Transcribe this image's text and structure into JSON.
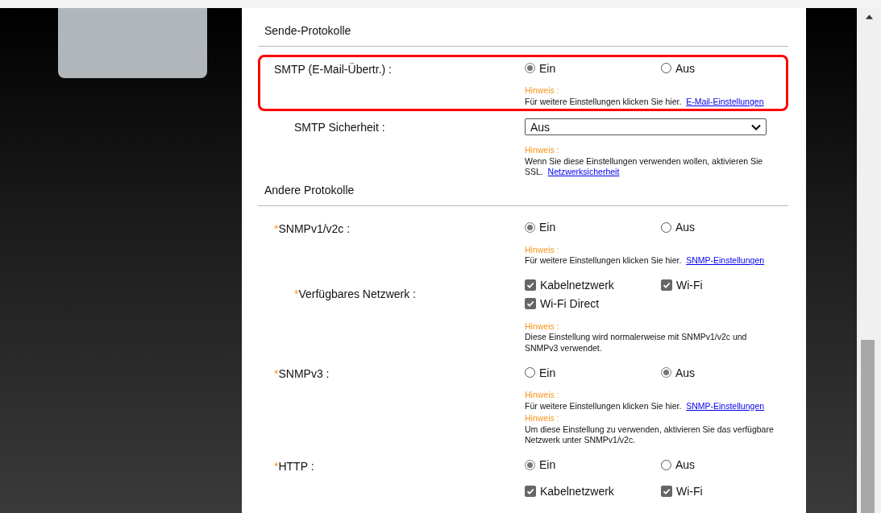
{
  "sections": [
    {
      "title": "Sende-Protokolle",
      "rows": [
        {
          "label": "SMTP (E-Mail-Übertr.) :",
          "sub": false,
          "highlighted": true,
          "kind": "radio",
          "options": [
            {
              "label": "Ein",
              "selected": true
            },
            {
              "label": "Aus",
              "selected": false
            }
          ],
          "notes": [
            {
              "label": "Hinweis :",
              "text": "Für weitere Einstellungen klicken Sie hier.",
              "link": "E-Mail-Einstellungen"
            }
          ]
        },
        {
          "label": "SMTP Sicherheit :",
          "sub": true,
          "highlighted": false,
          "kind": "select",
          "value": "Aus",
          "notes": [
            {
              "label": "Hinweis :",
              "text": "Wenn Sie diese Einstellungen verwenden wollen, aktivieren Sie SSL.",
              "link": "Netzwerksicherheit"
            }
          ]
        }
      ]
    },
    {
      "title": "Andere Protokolle",
      "rows": [
        {
          "marker": "*",
          "label": "SNMPv1/v2c :",
          "sub": false,
          "highlighted": false,
          "kind": "radio",
          "options": [
            {
              "label": "Ein",
              "selected": true
            },
            {
              "label": "Aus",
              "selected": false
            }
          ],
          "notes": [
            {
              "label": "Hinweis :",
              "text": "Für weitere Einstellungen klicken Sie hier.",
              "link": "SNMP-Einstellungen"
            }
          ]
        },
        {
          "marker": "*",
          "label": "Verfügbares Netzwerk :",
          "sub": true,
          "highlighted": false,
          "kind": "checkboxes",
          "options": [
            {
              "label": "Kabelnetzwerk",
              "checked": true
            },
            {
              "label": "Wi-Fi",
              "checked": true
            },
            {
              "label": "Wi-Fi Direct",
              "checked": true
            }
          ],
          "notes": [
            {
              "label": "Hinweis :",
              "text": "Diese Einstellung wird normalerweise mit SNMPv1/v2c und SNMPv3 verwendet."
            }
          ]
        },
        {
          "marker": "*",
          "label": "SNMPv3 :",
          "sub": false,
          "highlighted": false,
          "kind": "radio",
          "options": [
            {
              "label": "Ein",
              "selected": false
            },
            {
              "label": "Aus",
              "selected": true
            }
          ],
          "notes": [
            {
              "label": "Hinweis :",
              "text": "Für weitere Einstellungen klicken Sie hier.",
              "link": "SNMP-Einstellungen"
            },
            {
              "label": "Hinweis :",
              "text": "Um diese Einstellung zu verwenden, aktivieren Sie das verfügbare Netzwerk unter SNMPv1/v2c."
            }
          ]
        },
        {
          "marker": "*",
          "label": "HTTP :",
          "sub": false,
          "highlighted": false,
          "kind": "radio",
          "options": [
            {
              "label": "Ein",
              "selected": true
            },
            {
              "label": "Aus",
              "selected": false
            }
          ],
          "notes": []
        },
        {
          "sub": true,
          "highlighted": false,
          "kind": "checkboxes",
          "options": [
            {
              "label": "Kabelnetzwerk",
              "checked": true
            },
            {
              "label": "Wi-Fi",
              "checked": true
            }
          ],
          "notes": []
        }
      ]
    }
  ]
}
